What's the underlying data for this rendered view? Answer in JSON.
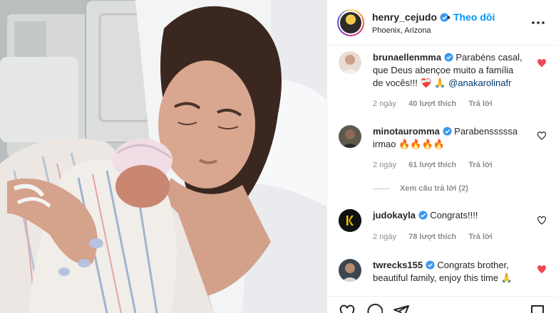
{
  "post": {
    "username": "henry_cejudo",
    "dot": "•",
    "follow_label": "Theo dõi",
    "location": "Phoenix, Arizona"
  },
  "comments": [
    {
      "username": "bruna­ellenmma",
      "text": "Parabéns casal, que Deus abençoe muito a família de vocês!!! ❤️‍🩹 🙏",
      "mention": "@anakarolinafr",
      "time": "2 ngày",
      "likes": "40 lượt thích",
      "reply": "Trả lời",
      "liked": true
    },
    {
      "username": "minotauromma",
      "text": "Parabensssssa irmao 🔥🔥🔥🔥",
      "time": "2 ngày",
      "likes": "61 lượt thích",
      "reply": "Trả lời",
      "liked": false
    },
    {
      "username": "judokayla",
      "text": "Congrats!!!!",
      "time": "2 ngày",
      "likes": "78 lượt thích",
      "reply": "Trả lời",
      "liked": false
    },
    {
      "username": "twrecks155",
      "text": "Congrats brother, beautiful family, enjoy this time 🙏",
      "liked": true
    }
  ],
  "view_replies_label": "Xem câu trả lời (2)",
  "colors": {
    "accent": "#0095f6",
    "verified": "#3897f0",
    "heart_liked": "#ed4956",
    "muted": "#8e8e8e"
  }
}
